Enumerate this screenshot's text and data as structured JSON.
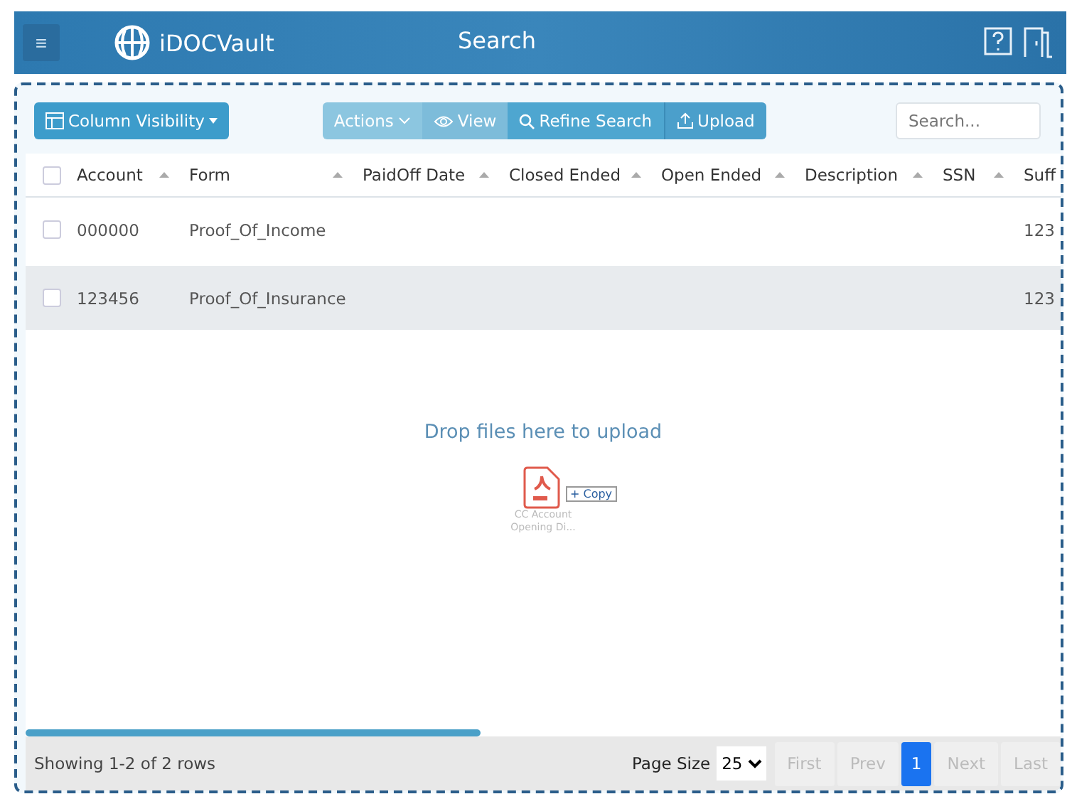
{
  "header": {
    "menu_icon": "≡",
    "brand": "iDOCVault",
    "title": "Search"
  },
  "toolbar": {
    "column_visibility": "Column Visibility",
    "actions": "Actions",
    "view": "View",
    "refine": "Refine Search",
    "upload": "Upload",
    "search": {
      "placeholder": "Search..."
    }
  },
  "table": {
    "select_all_checked": false,
    "columns": [
      {
        "label": "Account"
      },
      {
        "label": "Form"
      },
      {
        "label": "PaidOff Date"
      },
      {
        "label": "Closed Ended"
      },
      {
        "label": "Open Ended"
      },
      {
        "label": "Description"
      },
      {
        "label": "SSN"
      },
      {
        "label": "Suff"
      }
    ],
    "rows": [
      {
        "checked": false,
        "highlighted": false,
        "cells": [
          "000000",
          "Proof_Of_Income",
          "",
          "",
          "",
          "",
          "",
          "123"
        ]
      },
      {
        "checked": false,
        "highlighted": true,
        "cells": [
          "123456",
          "Proof_Of_Insurance",
          "",
          "",
          "",
          "",
          "",
          "123"
        ]
      }
    ]
  },
  "dropzone": {
    "message": "Drop files here to upload",
    "file_name": "CC Account Opening Di...",
    "badge": "+ Copy"
  },
  "footer": {
    "summary": "Showing 1-2 of 2 rows",
    "page_size_label": "Page Size",
    "page_size": "25",
    "pages": [
      {
        "label": "First",
        "disabled": true,
        "selected": false
      },
      {
        "label": "Prev",
        "disabled": true,
        "selected": false
      },
      {
        "label": "1",
        "disabled": false,
        "selected": true
      },
      {
        "label": "Next",
        "disabled": true,
        "selected": false
      },
      {
        "label": "Last",
        "disabled": true,
        "selected": false
      }
    ]
  }
}
